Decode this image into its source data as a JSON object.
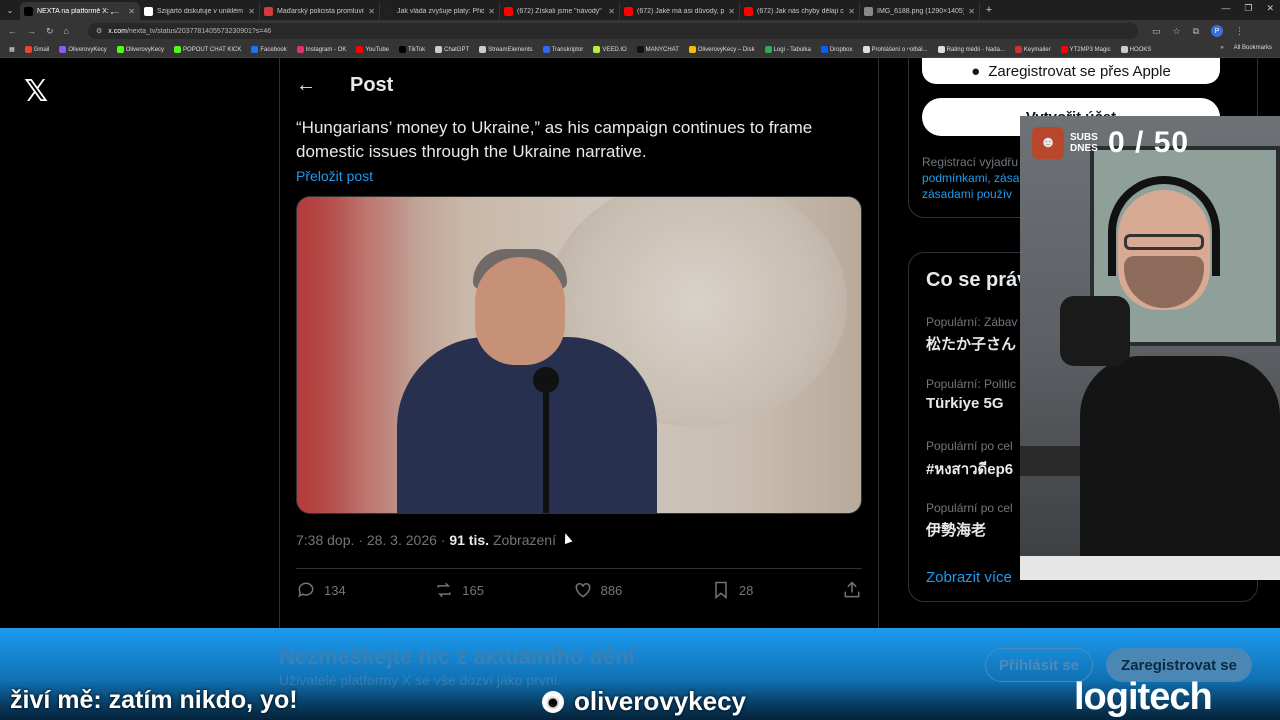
{
  "browser": {
    "tabs": [
      {
        "label": "NEXTA na platformě X: „...",
        "active": true,
        "fav_color": "#000000"
      },
      {
        "label": "Szijjártó diskutuje v uniklém ro",
        "active": false,
        "fav_color": "#ffffff"
      },
      {
        "label": "Maďarský policista promluvil o",
        "active": false,
        "fav_color": "#d63b3b"
      },
      {
        "label": "Jak vláda zvyšuje platy: Přidá li",
        "active": false,
        "fav_color": "#222222"
      },
      {
        "label": "(672) Získali jsme \"návody\" na",
        "active": false,
        "fav_color": "#ff0000"
      },
      {
        "label": "(672) Jaké má asi důvody, proč",
        "active": false,
        "fav_color": "#ff0000"
      },
      {
        "label": "(672) Jak nás chyby dělají chytř",
        "active": false,
        "fav_color": "#ff0000"
      },
      {
        "label": "IMG_6188.png (1290×1405)",
        "active": false,
        "fav_color": "#888888"
      }
    ],
    "url_host": "x.com",
    "url_path": "/nexta_tv/status/2037781405573230901?s=46",
    "bookmarks": [
      {
        "label": "Gmail",
        "color": "#ea4335"
      },
      {
        "label": "OliverovyKecy",
        "color": "#8a5cf6"
      },
      {
        "label": "OliverovyKecy",
        "color": "#53fc18"
      },
      {
        "label": "POPOUT CHAT KICK",
        "color": "#53fc18"
      },
      {
        "label": "Facebook",
        "color": "#1877f2"
      },
      {
        "label": "Instagram - OK",
        "color": "#e1306c"
      },
      {
        "label": "YouTube",
        "color": "#ff0000"
      },
      {
        "label": "TikTok",
        "color": "#000000"
      },
      {
        "label": "ChatGPT",
        "color": "#cccccc"
      },
      {
        "label": "StreamElements",
        "color": "#cccccc"
      },
      {
        "label": "Transkriptor",
        "color": "#2b6cf0"
      },
      {
        "label": "VEED.IO",
        "color": "#b5f23b"
      },
      {
        "label": "MANYCHAT",
        "color": "#111111"
      },
      {
        "label": "OliverovyKecy – Disk",
        "color": "#fbbc04"
      },
      {
        "label": "Logi - Tabulka",
        "color": "#34a853"
      },
      {
        "label": "Dropbox",
        "color": "#0061ff"
      },
      {
        "label": "Prohlášení o volbál...",
        "color": "#dddddd"
      },
      {
        "label": "Rating médií - Nada...",
        "color": "#dddddd"
      },
      {
        "label": "Keymailer",
        "color": "#cc3333"
      },
      {
        "label": "YT2MP3 Magic",
        "color": "#ff0000"
      },
      {
        "label": "HOOKS",
        "color": "#cccccc"
      }
    ],
    "all_bookmarks": "All Bookmarks",
    "profile_initial": "P"
  },
  "x": {
    "logo": "𝕏",
    "header_title": "Post",
    "post_text": "“Hungarians’ money to Ukraine,” as his campaign continues to frame domestic issues through the Ukraine narrative.",
    "translate": "Přeložit post",
    "meta_time": "7:38 dop. · 28. 3. 2026 · ",
    "meta_views": "91 tis.",
    "meta_views_label": "Zobrazení",
    "replies": "134",
    "reposts": "165",
    "likes": "886",
    "bookmarks": "28"
  },
  "sidebar": {
    "apple_button": "Zaregistrovat se přes Apple",
    "login_button": "Vytvořit účet",
    "reg_text_start": "Registrací vyjadřu",
    "reg_link1": "podmínkami, zása",
    "reg_link2": "zásadami použív",
    "trends_title": "Co se práv",
    "trends": [
      {
        "category": "Populární: Zábav",
        "name": "松たか子さん"
      },
      {
        "category": "Populární: Politic",
        "name": "Türkiye 5G"
      },
      {
        "category": "Populární po cel",
        "name": "#หงสาวดีep6"
      },
      {
        "category": "Populární po cel",
        "name": "伊勢海老"
      }
    ],
    "show_more": "Zobrazit více"
  },
  "banner": {
    "title": "Nezmeškejte nic z aktuálního dění",
    "subtitle": "Uživatelé platformy X se vše dozví jako první.",
    "login": "Přihlásit se",
    "register": "Zaregistrovat se"
  },
  "stream": {
    "counter_label_1": "SUBS",
    "counter_label_2": "DNES",
    "counter_value": "0 / 50",
    "support_text": "živí mě: zatím nikdo, yo!",
    "handle": "oliverovykecy",
    "sponsor": "logitech"
  }
}
